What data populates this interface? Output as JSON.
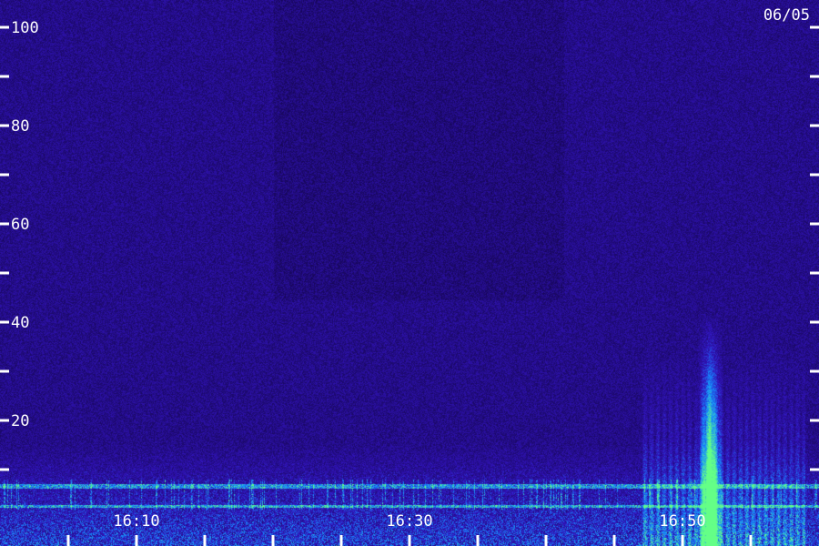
{
  "chart_data": {
    "type": "heatmap",
    "title": "",
    "xlabel": "",
    "ylabel": "",
    "date": "06/05",
    "y_ticks": [
      {
        "value": 100,
        "label": "100"
      },
      {
        "value": 80,
        "label": "80"
      },
      {
        "value": 60,
        "label": "60"
      },
      {
        "value": 40,
        "label": "40"
      },
      {
        "value": 20,
        "label": "20"
      }
    ],
    "ylim": [
      0,
      100
    ],
    "x_range": [
      "16:00",
      "17:00"
    ],
    "x_ticks": [
      {
        "time": "16:10",
        "label": "16:10"
      },
      {
        "time": "16:30",
        "label": "16:30"
      },
      {
        "time": "16:50",
        "label": "16:50"
      }
    ],
    "colors": {
      "background": "#2a0aa0",
      "low": "#000000",
      "mid": "#2040ff",
      "high": "#40ff80"
    },
    "features": [
      {
        "kind": "persistent-band",
        "freq_low": 2,
        "freq_high": 8,
        "level": "high"
      },
      {
        "kind": "burst",
        "time": "16:52",
        "freq_low": 5,
        "freq_high": 42,
        "level": "high"
      },
      {
        "kind": "burst-group",
        "time_start": "16:47",
        "time_end": "16:59",
        "freq_low": 5,
        "freq_high": 35,
        "level": "mid"
      }
    ]
  }
}
